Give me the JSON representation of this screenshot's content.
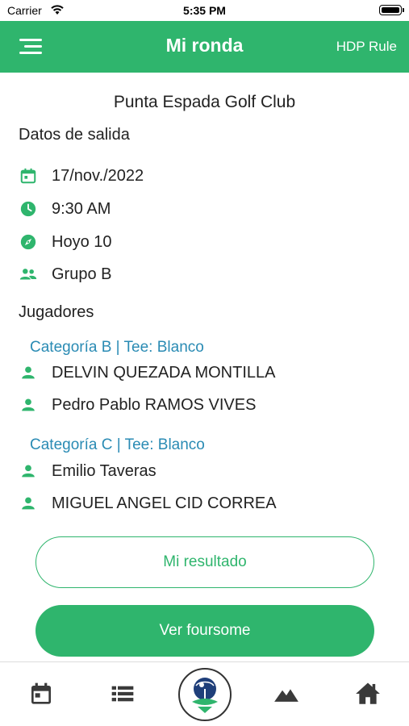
{
  "status_bar": {
    "carrier": "Carrier",
    "time": "5:35 PM"
  },
  "header": {
    "title": "Mi ronda",
    "right_action": "HDP Rule"
  },
  "club_name": "Punta Espada Golf Club",
  "tee_time_section": {
    "heading": "Datos de salida",
    "items": [
      {
        "icon": "calendar-icon",
        "value": "17/nov./2022"
      },
      {
        "icon": "clock-icon",
        "value": "9:30 AM"
      },
      {
        "icon": "compass-icon",
        "value": "Hoyo 10"
      },
      {
        "icon": "group-icon",
        "value": "Grupo B"
      }
    ]
  },
  "players_section": {
    "heading": "Jugadores",
    "categories": [
      {
        "label": "Categoría B | Tee: Blanco",
        "players": [
          "DELVIN QUEZADA MONTILLA",
          "Pedro Pablo RAMOS VIVES"
        ]
      },
      {
        "label": "Categoría C | Tee: Blanco",
        "players": [
          "Emilio Taveras",
          "MIGUEL ANGEL CID CORREA"
        ]
      }
    ]
  },
  "buttons": {
    "my_result": "Mi resultado",
    "view_foursome": "Ver foursome"
  },
  "tab_bar": {
    "items": [
      "calendar-tab-icon",
      "list-tab-icon",
      "club-logo-icon",
      "mountains-tab-icon",
      "home-tab-icon"
    ]
  },
  "colors": {
    "accent": "#2fb56d",
    "category": "#2a8bb4",
    "icon_dark": "#3a3a3a"
  }
}
